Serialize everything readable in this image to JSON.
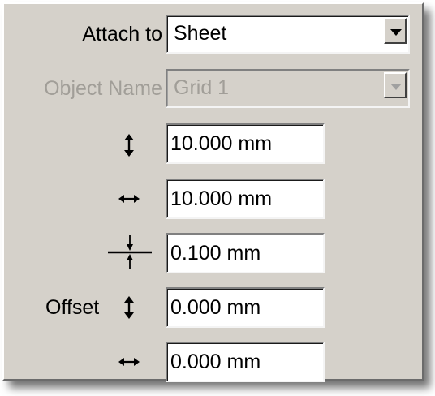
{
  "attach_to": {
    "label": "Attach to",
    "value": "Sheet"
  },
  "object_name": {
    "label": "Object Name",
    "value": "Grid 1",
    "enabled": false
  },
  "grid_spacing_vertical": {
    "icon": "vertical-double-arrow-icon",
    "value": "10.000 mm"
  },
  "grid_spacing_horizontal": {
    "icon": "horizontal-double-arrow-icon",
    "value": "10.000 mm"
  },
  "snap_tolerance": {
    "icon": "crosshair-arrows-icon",
    "value": "0.100 mm"
  },
  "offset": {
    "label": "Offset",
    "vertical_icon": "vertical-double-arrow-icon",
    "vertical_value": "0.000 mm",
    "horizontal_icon": "horizontal-double-arrow-icon",
    "horizontal_value": "0.000 mm"
  },
  "colors": {
    "panel_bg": "#d5d1ca",
    "disabled_text": "#a19e98"
  }
}
